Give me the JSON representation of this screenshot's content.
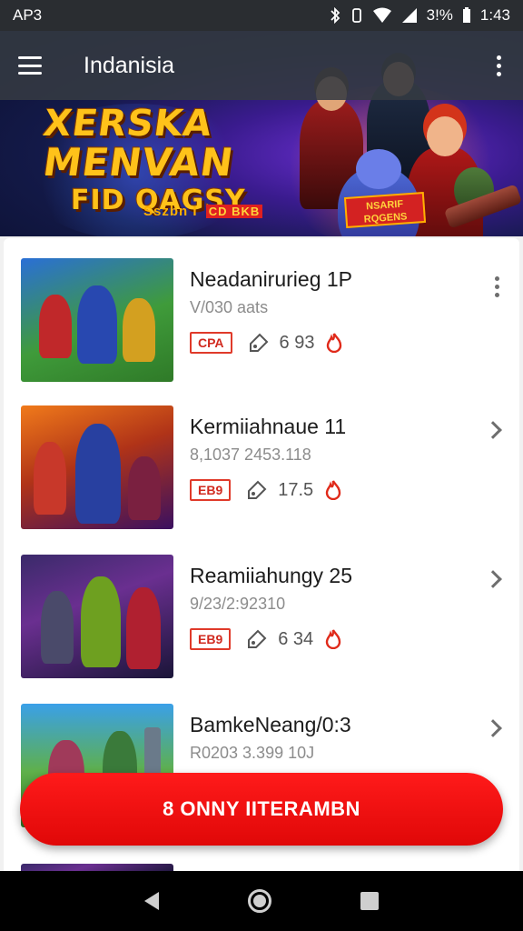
{
  "status_bar": {
    "carrier": "AP3",
    "battery": "3!%",
    "time": "1:43"
  },
  "app_bar": {
    "title": "Indanisia"
  },
  "hero": {
    "title_line1": "XERSKA",
    "title_line2": "MENVAN",
    "title_line3": "FID QAGSY",
    "subtitle": "Sszbn I",
    "subtitle_tag": "CD BKB",
    "badge": "NSARIF RQGENS"
  },
  "games": [
    {
      "title": "Neadanirurieg 1P",
      "subtitle": "V/030 aats",
      "badge": "CPA",
      "value": "6 93",
      "action": "more-vert"
    },
    {
      "title": "Kermiiahnaue 11",
      "subtitle": "8,1037 2453.118",
      "badge": "EB9",
      "value": "17.5",
      "action": "chevron"
    },
    {
      "title": "Reamiiahungy 25",
      "subtitle": "9/23/2:92310",
      "badge": "EB9",
      "value": "6 34",
      "action": "chevron"
    },
    {
      "title": "BamkeNeang/0:3",
      "subtitle": "R0203 3.399 10J",
      "badge": "",
      "value": "",
      "action": "chevron"
    }
  ],
  "cta": {
    "label": "8 ONNY IITERAMBN"
  },
  "colors": {
    "accent": "#e60b0b",
    "app_bar": "#343a42",
    "badge_red": "#e03a2a"
  }
}
